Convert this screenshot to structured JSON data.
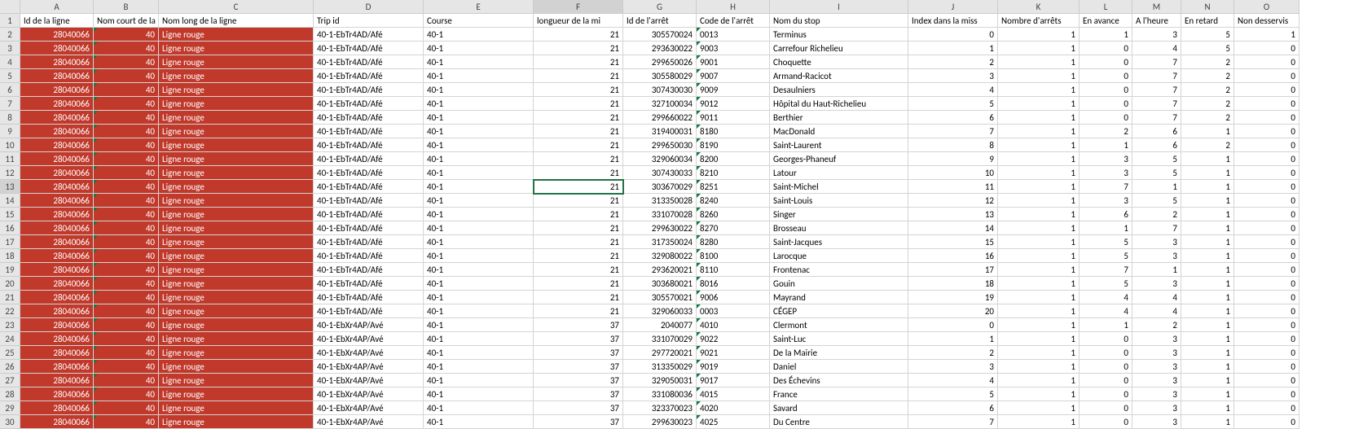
{
  "columns": [
    "A",
    "B",
    "C",
    "D",
    "E",
    "F",
    "G",
    "H",
    "I",
    "J",
    "K",
    "L",
    "M",
    "N",
    "O"
  ],
  "headers": {
    "A": "Id de la ligne",
    "B": "Nom court de la li",
    "C": "Nom long de la ligne",
    "D": "Trip id",
    "E": "Course",
    "F": "longueur de la mi",
    "G": "Id de l'arrêt",
    "H": "Code de l'arrêt",
    "I": "Nom du stop",
    "J": "Index dans la miss",
    "K": "Nombre d'arrêts",
    "L": "En avance",
    "M": "A l'heure",
    "N": "En retard",
    "O": "Non desservis"
  },
  "active_cell": {
    "row": 13,
    "col": "F"
  },
  "rows": [
    {
      "A": 28040066,
      "B": 40,
      "C": "Ligne rouge",
      "D": "40-1-EbTr4AD/Afé",
      "E": "40-1",
      "F": 21,
      "G": 305570024,
      "H": "0013",
      "I": "Terminus",
      "J": 0,
      "K": 1,
      "L": 1,
      "M": 3,
      "N": 5,
      "O": 1
    },
    {
      "A": 28040066,
      "B": 40,
      "C": "Ligne rouge",
      "D": "40-1-EbTr4AD/Afé",
      "E": "40-1",
      "F": 21,
      "G": 293630022,
      "H": "9003",
      "I": "Carrefour Richelieu",
      "J": 1,
      "K": 1,
      "L": 0,
      "M": 4,
      "N": 5,
      "O": 0
    },
    {
      "A": 28040066,
      "B": 40,
      "C": "Ligne rouge",
      "D": "40-1-EbTr4AD/Afé",
      "E": "40-1",
      "F": 21,
      "G": 299650026,
      "H": "9001",
      "I": "Choquette",
      "J": 2,
      "K": 1,
      "L": 0,
      "M": 7,
      "N": 2,
      "O": 0
    },
    {
      "A": 28040066,
      "B": 40,
      "C": "Ligne rouge",
      "D": "40-1-EbTr4AD/Afé",
      "E": "40-1",
      "F": 21,
      "G": 305580029,
      "H": "9007",
      "I": "Armand-Racicot",
      "J": 3,
      "K": 1,
      "L": 0,
      "M": 7,
      "N": 2,
      "O": 0
    },
    {
      "A": 28040066,
      "B": 40,
      "C": "Ligne rouge",
      "D": "40-1-EbTr4AD/Afé",
      "E": "40-1",
      "F": 21,
      "G": 307430030,
      "H": "9009",
      "I": "Desaulniers",
      "J": 4,
      "K": 1,
      "L": 0,
      "M": 7,
      "N": 2,
      "O": 0
    },
    {
      "A": 28040066,
      "B": 40,
      "C": "Ligne rouge",
      "D": "40-1-EbTr4AD/Afé",
      "E": "40-1",
      "F": 21,
      "G": 327100034,
      "H": "9012",
      "I": "Hôpital du Haut-Richelieu",
      "J": 5,
      "K": 1,
      "L": 0,
      "M": 7,
      "N": 2,
      "O": 0
    },
    {
      "A": 28040066,
      "B": 40,
      "C": "Ligne rouge",
      "D": "40-1-EbTr4AD/Afé",
      "E": "40-1",
      "F": 21,
      "G": 299660022,
      "H": "9011",
      "I": "Berthier",
      "J": 6,
      "K": 1,
      "L": 0,
      "M": 7,
      "N": 2,
      "O": 0
    },
    {
      "A": 28040066,
      "B": 40,
      "C": "Ligne rouge",
      "D": "40-1-EbTr4AD/Afé",
      "E": "40-1",
      "F": 21,
      "G": 319400031,
      "H": "8180",
      "I": "MacDonald",
      "J": 7,
      "K": 1,
      "L": 2,
      "M": 6,
      "N": 1,
      "O": 0
    },
    {
      "A": 28040066,
      "B": 40,
      "C": "Ligne rouge",
      "D": "40-1-EbTr4AD/Afé",
      "E": "40-1",
      "F": 21,
      "G": 299650030,
      "H": "8190",
      "I": "Saint-Laurent",
      "J": 8,
      "K": 1,
      "L": 1,
      "M": 6,
      "N": 2,
      "O": 0
    },
    {
      "A": 28040066,
      "B": 40,
      "C": "Ligne rouge",
      "D": "40-1-EbTr4AD/Afé",
      "E": "40-1",
      "F": 21,
      "G": 329060034,
      "H": "8200",
      "I": "Georges-Phaneuf",
      "J": 9,
      "K": 1,
      "L": 3,
      "M": 5,
      "N": 1,
      "O": 0
    },
    {
      "A": 28040066,
      "B": 40,
      "C": "Ligne rouge",
      "D": "40-1-EbTr4AD/Afé",
      "E": "40-1",
      "F": 21,
      "G": 307430033,
      "H": "8210",
      "I": "Latour",
      "J": 10,
      "K": 1,
      "L": 3,
      "M": 5,
      "N": 1,
      "O": 0
    },
    {
      "A": 28040066,
      "B": 40,
      "C": "Ligne rouge",
      "D": "40-1-EbTr4AD/Afé",
      "E": "40-1",
      "F": 21,
      "G": 303670029,
      "H": "8251",
      "I": "Saint-Michel",
      "J": 11,
      "K": 1,
      "L": 7,
      "M": 1,
      "N": 1,
      "O": 0
    },
    {
      "A": 28040066,
      "B": 40,
      "C": "Ligne rouge",
      "D": "40-1-EbTr4AD/Afé",
      "E": "40-1",
      "F": 21,
      "G": 313350028,
      "H": "8240",
      "I": "Saint-Louis",
      "J": 12,
      "K": 1,
      "L": 3,
      "M": 5,
      "N": 1,
      "O": 0
    },
    {
      "A": 28040066,
      "B": 40,
      "C": "Ligne rouge",
      "D": "40-1-EbTr4AD/Afé",
      "E": "40-1",
      "F": 21,
      "G": 331070028,
      "H": "8260",
      "I": "Singer",
      "J": 13,
      "K": 1,
      "L": 6,
      "M": 2,
      "N": 1,
      "O": 0
    },
    {
      "A": 28040066,
      "B": 40,
      "C": "Ligne rouge",
      "D": "40-1-EbTr4AD/Afé",
      "E": "40-1",
      "F": 21,
      "G": 299630022,
      "H": "8270",
      "I": "Brosseau",
      "J": 14,
      "K": 1,
      "L": 1,
      "M": 7,
      "N": 1,
      "O": 0
    },
    {
      "A": 28040066,
      "B": 40,
      "C": "Ligne rouge",
      "D": "40-1-EbTr4AD/Afé",
      "E": "40-1",
      "F": 21,
      "G": 317350024,
      "H": "8280",
      "I": "Saint-Jacques",
      "J": 15,
      "K": 1,
      "L": 5,
      "M": 3,
      "N": 1,
      "O": 0
    },
    {
      "A": 28040066,
      "B": 40,
      "C": "Ligne rouge",
      "D": "40-1-EbTr4AD/Afé",
      "E": "40-1",
      "F": 21,
      "G": 329080022,
      "H": "8100",
      "I": "Larocque",
      "J": 16,
      "K": 1,
      "L": 5,
      "M": 3,
      "N": 1,
      "O": 0
    },
    {
      "A": 28040066,
      "B": 40,
      "C": "Ligne rouge",
      "D": "40-1-EbTr4AD/Afé",
      "E": "40-1",
      "F": 21,
      "G": 293620021,
      "H": "8110",
      "I": "Frontenac",
      "J": 17,
      "K": 1,
      "L": 7,
      "M": 1,
      "N": 1,
      "O": 0
    },
    {
      "A": 28040066,
      "B": 40,
      "C": "Ligne rouge",
      "D": "40-1-EbTr4AD/Afé",
      "E": "40-1",
      "F": 21,
      "G": 303680021,
      "H": "8016",
      "I": "Gouin",
      "J": 18,
      "K": 1,
      "L": 5,
      "M": 3,
      "N": 1,
      "O": 0
    },
    {
      "A": 28040066,
      "B": 40,
      "C": "Ligne rouge",
      "D": "40-1-EbTr4AD/Afé",
      "E": "40-1",
      "F": 21,
      "G": 305570021,
      "H": "9006",
      "I": "Mayrand",
      "J": 19,
      "K": 1,
      "L": 4,
      "M": 4,
      "N": 1,
      "O": 0
    },
    {
      "A": 28040066,
      "B": 40,
      "C": "Ligne rouge",
      "D": "40-1-EbTr4AD/Afé",
      "E": "40-1",
      "F": 21,
      "G": 329060033,
      "H": "0003",
      "I": "CÉGEP",
      "J": 20,
      "K": 1,
      "L": 4,
      "M": 4,
      "N": 1,
      "O": 0
    },
    {
      "A": 28040066,
      "B": 40,
      "C": "Ligne rouge",
      "D": "40-1-EbXr4AP/Avé",
      "E": "40-1",
      "F": 37,
      "G": 2040077,
      "H": "4010",
      "I": "Clermont",
      "J": 0,
      "K": 1,
      "L": 1,
      "M": 2,
      "N": 1,
      "O": 0
    },
    {
      "A": 28040066,
      "B": 40,
      "C": "Ligne rouge",
      "D": "40-1-EbXr4AP/Avé",
      "E": "40-1",
      "F": 37,
      "G": 331070029,
      "H": "9022",
      "I": "Saint-Luc",
      "J": 1,
      "K": 1,
      "L": 0,
      "M": 3,
      "N": 1,
      "O": 0
    },
    {
      "A": 28040066,
      "B": 40,
      "C": "Ligne rouge",
      "D": "40-1-EbXr4AP/Avé",
      "E": "40-1",
      "F": 37,
      "G": 297720021,
      "H": "9021",
      "I": "De la Mairie",
      "J": 2,
      "K": 1,
      "L": 0,
      "M": 3,
      "N": 1,
      "O": 0
    },
    {
      "A": 28040066,
      "B": 40,
      "C": "Ligne rouge",
      "D": "40-1-EbXr4AP/Avé",
      "E": "40-1",
      "F": 37,
      "G": 313350029,
      "H": "9019",
      "I": "Daniel",
      "J": 3,
      "K": 1,
      "L": 0,
      "M": 3,
      "N": 1,
      "O": 0
    },
    {
      "A": 28040066,
      "B": 40,
      "C": "Ligne rouge",
      "D": "40-1-EbXr4AP/Avé",
      "E": "40-1",
      "F": 37,
      "G": 329050031,
      "H": "9017",
      "I": "Des Échevins",
      "J": 4,
      "K": 1,
      "L": 0,
      "M": 3,
      "N": 1,
      "O": 0
    },
    {
      "A": 28040066,
      "B": 40,
      "C": "Ligne rouge",
      "D": "40-1-EbXr4AP/Avé",
      "E": "40-1",
      "F": 37,
      "G": 331080036,
      "H": "4015",
      "I": "France",
      "J": 5,
      "K": 1,
      "L": 0,
      "M": 3,
      "N": 1,
      "O": 0
    },
    {
      "A": 28040066,
      "B": 40,
      "C": "Ligne rouge",
      "D": "40-1-EbXr4AP/Avé",
      "E": "40-1",
      "F": 37,
      "G": 323370023,
      "H": "4020",
      "I": "Savard",
      "J": 6,
      "K": 1,
      "L": 0,
      "M": 3,
      "N": 1,
      "O": 0
    },
    {
      "A": 28040066,
      "B": 40,
      "C": "Ligne rouge",
      "D": "40-1-EbXr4AP/Avé",
      "E": "40-1",
      "F": 37,
      "G": 299630023,
      "H": "4025",
      "I": "Du Centre",
      "J": 7,
      "K": 1,
      "L": 0,
      "M": 3,
      "N": 1,
      "O": 0
    }
  ]
}
